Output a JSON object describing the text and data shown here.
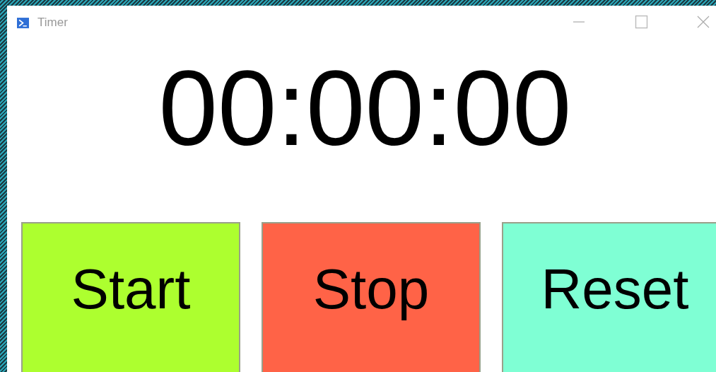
{
  "window": {
    "title": "Timer"
  },
  "display": {
    "time": "00:00:00"
  },
  "buttons": [
    {
      "label": "Start",
      "color": "#adff2f"
    },
    {
      "label": "Stop",
      "color": "#ff6347"
    },
    {
      "label": "Reset",
      "color": "#7fffd4"
    }
  ]
}
